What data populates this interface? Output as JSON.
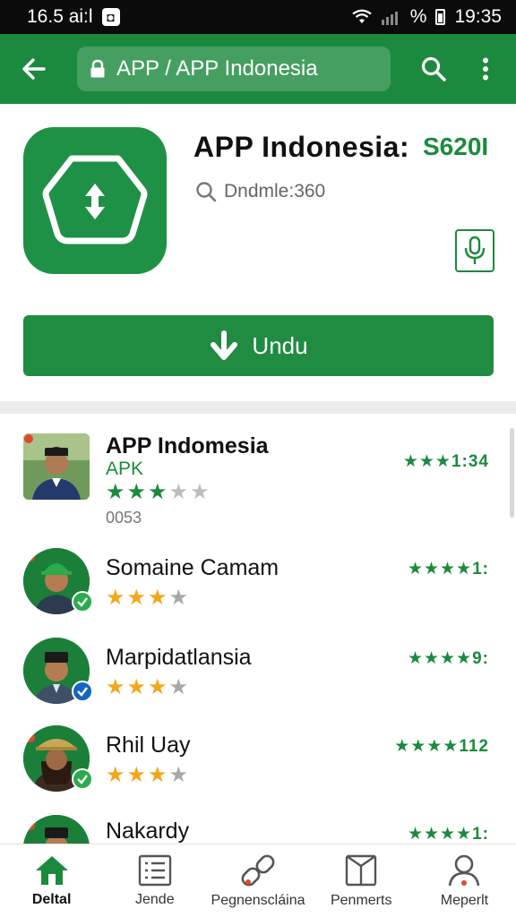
{
  "status_bar": {
    "time_left": "16.5 ai:l",
    "battery_text": "%",
    "time_right": "19:35"
  },
  "app_bar": {
    "url_text": "APP / APP  Indonesia"
  },
  "app_header": {
    "title": "APP  Indonesia:",
    "version": "S620I",
    "downloads": "Dndmle:360",
    "download_button_label": "Undu"
  },
  "list": [
    {
      "name": "APP Indomesia",
      "subtitle": "APK",
      "count": "0053",
      "rating_stars": 3,
      "score": "1:34",
      "score_stars": 3
    },
    {
      "name": "Somaine Camam",
      "rating_stars": 3,
      "score": "1:",
      "score_stars": 4
    },
    {
      "name": "Marpidatlansia",
      "rating_stars": 3,
      "score": "9:",
      "score_stars": 4
    },
    {
      "name": "Rhil Uay",
      "rating_stars": 3,
      "score": "112",
      "score_stars": 4
    },
    {
      "name": "Nakardy",
      "score": "1:",
      "score_stars": 4
    }
  ],
  "bottom_nav": {
    "items": [
      {
        "label": "Deltal",
        "icon": "home-icon"
      },
      {
        "label": "Jende",
        "icon": "list-icon"
      },
      {
        "label": "Pegnenscláina",
        "icon": "link-icon"
      },
      {
        "label": "Penmerts",
        "icon": "book-icon"
      },
      {
        "label": "Meperlt",
        "icon": "person-icon"
      }
    ]
  },
  "colors": {
    "primary_green": "#1c8a3e",
    "star_orange": "#f2a71b",
    "star_gray": "#a8a8a8",
    "status_bar": "#0b0b0b"
  }
}
